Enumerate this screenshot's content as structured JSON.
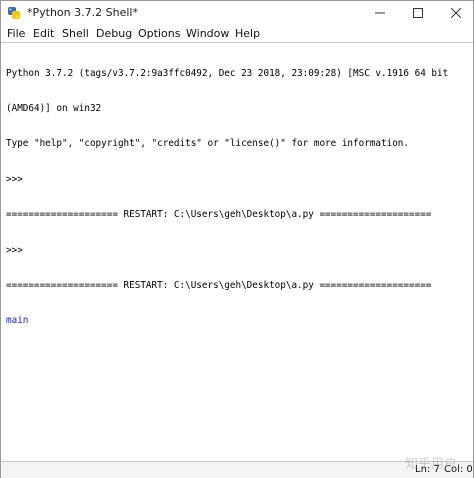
{
  "titlebar": {
    "title": "*Python 3.7.2 Shell*",
    "minimize_icon": "minimize-icon",
    "maximize_icon": "maximize-icon",
    "close_icon": "close-icon"
  },
  "menubar": {
    "items": [
      "File",
      "Edit",
      "Shell",
      "Debug",
      "Options",
      "Window",
      "Help"
    ]
  },
  "shell": {
    "lines": [
      {
        "text": "Python 3.7.2 (tags/v3.7.2:9a3ffc0492, Dec 23 2018, 23:09:28) [MSC v.1916 64 bit",
        "kind": "out"
      },
      {
        "text": "(AMD64)] on win32",
        "kind": "out"
      },
      {
        "text": "Type \"help\", \"copyright\", \"credits\" or \"license()\" for more information.",
        "kind": "out"
      },
      {
        "text": ">>> ",
        "kind": "out"
      },
      {
        "text": "==================== RESTART: C:\\Users\\geh\\Desktop\\a.py ====================",
        "kind": "out"
      },
      {
        "text": ">>> ",
        "kind": "out"
      },
      {
        "text": "==================== RESTART: C:\\Users\\geh\\Desktop\\a.py ====================",
        "kind": "out"
      },
      {
        "text": "main",
        "kind": "stdout"
      }
    ],
    "colors": {
      "stdout": "#1f29a3",
      "text": "#000000"
    }
  },
  "statusbar": {
    "ln": "Ln: 7",
    "col": "Col: 0"
  },
  "watermark": "知乎用户"
}
